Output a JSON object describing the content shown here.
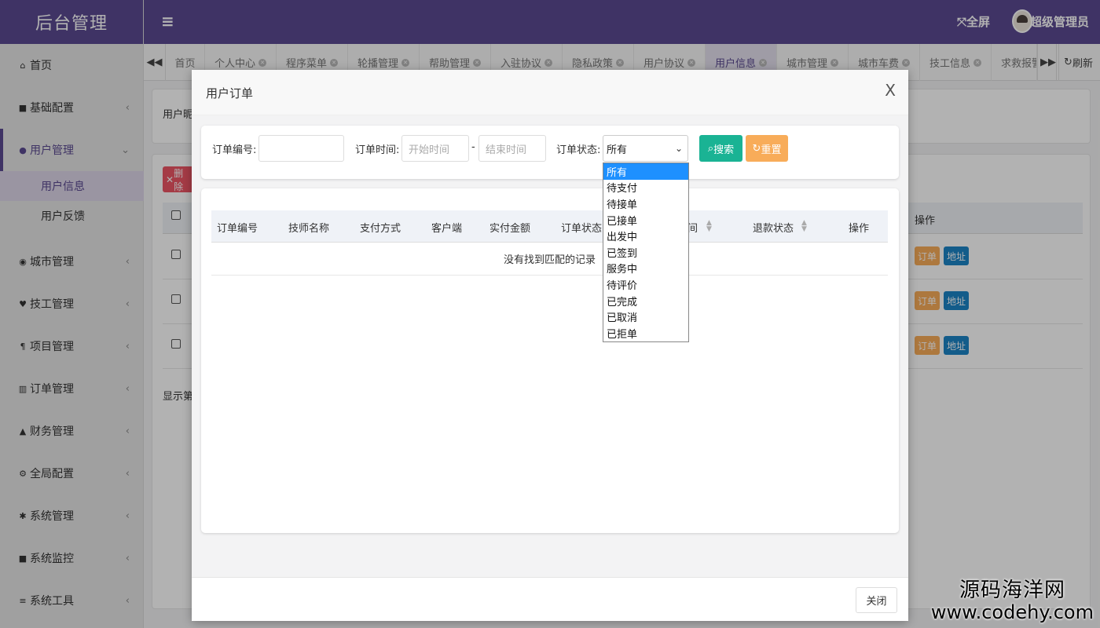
{
  "app": {
    "logo": "后台管理",
    "fullscreen": "全屏",
    "username": "超级管理员"
  },
  "sidebar": {
    "items": [
      {
        "label": "首页",
        "icon": "home-icon"
      },
      {
        "label": "基础配置",
        "icon": "bookmark-icon"
      },
      {
        "label": "用户管理",
        "icon": "user-icon"
      },
      {
        "label": "城市管理",
        "icon": "globe-icon"
      },
      {
        "label": "技工管理",
        "icon": "heart-icon"
      },
      {
        "label": "项目管理",
        "icon": "paragraph-icon"
      },
      {
        "label": "订单管理",
        "icon": "bar-chart-icon"
      },
      {
        "label": "财务管理",
        "icon": "area-chart-icon"
      },
      {
        "label": "全局配置",
        "icon": "cogs-icon"
      },
      {
        "label": "系统管理",
        "icon": "gear-icon"
      },
      {
        "label": "系统监控",
        "icon": "video-camera-icon"
      },
      {
        "label": "系统工具",
        "icon": "bars-icon"
      }
    ],
    "subitems": [
      {
        "label": "用户信息"
      },
      {
        "label": "用户反馈"
      }
    ]
  },
  "tabs": {
    "items": [
      {
        "label": "首页"
      },
      {
        "label": "个人中心"
      },
      {
        "label": "程序菜单"
      },
      {
        "label": "轮播管理"
      },
      {
        "label": "帮助管理"
      },
      {
        "label": "入驻协议"
      },
      {
        "label": "隐私政策"
      },
      {
        "label": "用户协议"
      },
      {
        "label": "用户信息"
      },
      {
        "label": "城市管理"
      },
      {
        "label": "城市车费"
      },
      {
        "label": "技工信息"
      },
      {
        "label": "求救报警"
      }
    ],
    "refresh": "刷新"
  },
  "background": {
    "filter_label": "用户昵",
    "delete_btn": "删除",
    "col_operation": "操作",
    "row_btn_order": "订单",
    "row_btn_address": "地址",
    "pagination": "显示第"
  },
  "modal": {
    "title": "用户订单",
    "close_x": "X",
    "search": {
      "order_no_label": "订单编号:",
      "order_time_label": "订单时间:",
      "start_placeholder": "开始时间",
      "dash": "-",
      "end_placeholder": "结束时间",
      "status_label": "订单状态:",
      "status_value": "所有",
      "search_btn": "搜索",
      "reset_btn": "重置"
    },
    "table": {
      "columns": [
        "订单编号",
        "技师名称",
        "支付方式",
        "客户端",
        "实付金额",
        "订单状态",
        "间",
        "退款状态",
        "操作"
      ],
      "empty": "没有找到匹配的记录"
    },
    "footer_close": "关闭"
  },
  "dropdown": {
    "options": [
      "所有",
      "待支付",
      "待接单",
      "已接单",
      "出发中",
      "已签到",
      "服务中",
      "待评价",
      "已完成",
      "已取消",
      "已拒单"
    ]
  },
  "watermark": {
    "line1": "源码海洋网",
    "line2": "www.codehy.com"
  },
  "colors": {
    "brand": "#5b4a91",
    "search": "#1ab394",
    "reset": "#f8ac59",
    "order_btn": "#f8ac59",
    "address_btn": "#1c84c6",
    "danger": "#ed5565",
    "selected": "#1e90ff"
  }
}
